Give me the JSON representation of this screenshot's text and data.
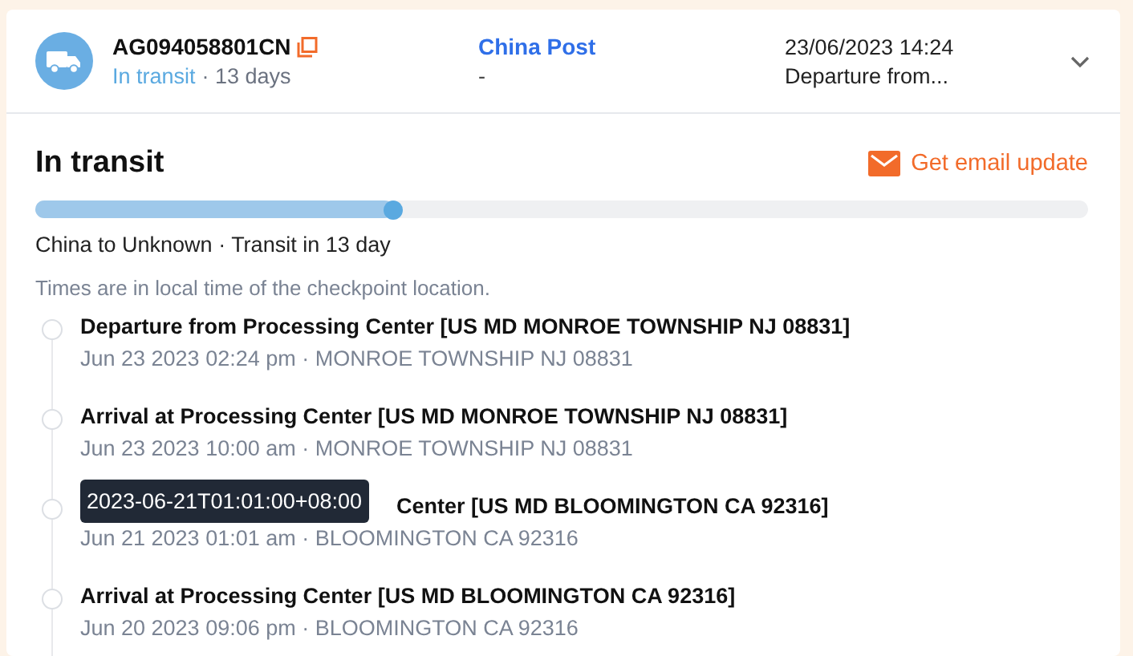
{
  "header": {
    "tracking_number": "AG094058801CN",
    "status": "In transit",
    "duration": "· 13 days",
    "carrier": "China Post",
    "carrier_sub": "-",
    "latest_time": "23/06/2023 14:24",
    "latest_event": "Departure from...",
    "expanded": true
  },
  "summary": {
    "title": "In transit",
    "email_link": "Get email update",
    "level": 0.34,
    "route": "China to Unknown · Transit in 13 day",
    "note": "Times are in local time of the checkpoint location."
  },
  "events": [
    {
      "title": "Departure from Processing Center [US MD MONROE TOWNSHIP NJ 08831]",
      "detail": "Jun 23 2023 02:24 pm · MONROE TOWNSHIP NJ 08831"
    },
    {
      "title": "Arrival at Processing Center [US MD MONROE TOWNSHIP NJ 08831]",
      "detail": "Jun 23 2023 10:00 am · MONROE TOWNSHIP NJ 08831"
    },
    {
      "title": "Center [US MD BLOOMINGTON CA 92316]",
      "detail": "Jun 21 2023 01:01 am · BLOOMINGTON CA 92316",
      "tooltip": "2023-06-21T01:01:00+08:00"
    },
    {
      "title": "Arrival at Processing Center [US MD BLOOMINGTON CA 92316]",
      "detail": "Jun 20 2023 09:06 pm · BLOOMINGTON CA 92316"
    }
  ]
}
